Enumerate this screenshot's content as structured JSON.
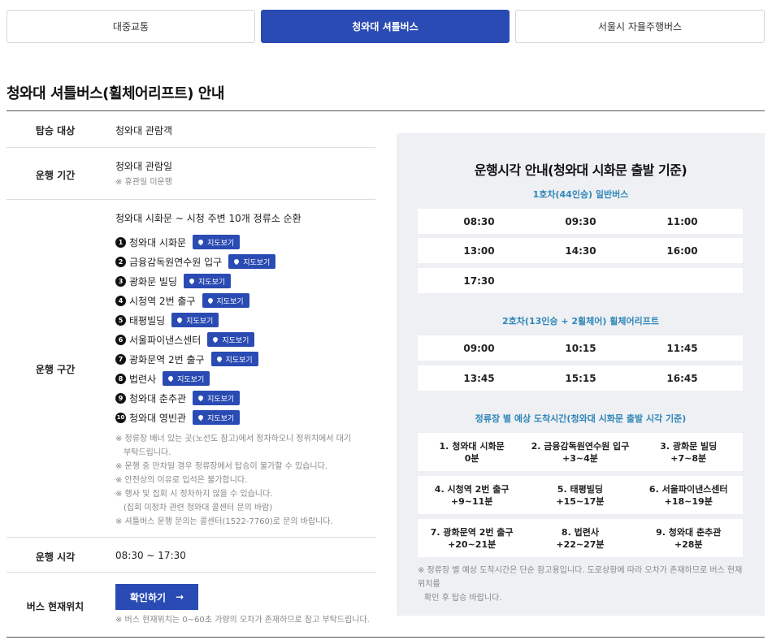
{
  "tabs": [
    {
      "label": "대중교통",
      "active": false
    },
    {
      "label": "청와대 셔틀버스",
      "active": true
    },
    {
      "label": "서울시 자율주행버스",
      "active": false
    }
  ],
  "title": "청와대 셔틀버스(휠체어리프트) 안내",
  "info": {
    "target": {
      "label": "탑승 대상",
      "value": "청와대 관람객"
    },
    "period": {
      "label": "운행 기간",
      "value": "청와대 관람일",
      "note": "※ 휴관일 미운행"
    },
    "route": {
      "label": "운행 구간",
      "summary": "청와대 시화문 ~ 시청 주변 10개 정류소 순환",
      "map_label": "지도보기",
      "stops": [
        {
          "num": "1",
          "name": "청와대 시화문"
        },
        {
          "num": "2",
          "name": "금융감독원연수원 입구"
        },
        {
          "num": "3",
          "name": "광화문 빌딩"
        },
        {
          "num": "4",
          "name": "시청역 2번 출구"
        },
        {
          "num": "5",
          "name": "태평빌딩"
        },
        {
          "num": "6",
          "name": "서울파이낸스센터"
        },
        {
          "num": "7",
          "name": "광화문역 2번 출구"
        },
        {
          "num": "8",
          "name": "법련사"
        },
        {
          "num": "9",
          "name": "청와대 춘추관"
        },
        {
          "num": "10",
          "name": "청와대 영빈관"
        }
      ],
      "notes": [
        "※ 정류장 배너 있는 곳(노선도 참고)에서 정차하오니 정위치에서 대기",
        "부탁드립니다.",
        "※ 운행 중 만차일 경우 정류장에서 탑승이 불가할 수 있습니다.",
        "※ 안전상의 이유로 입석은 불가합니다.",
        "※ 행사 및 집회 시 정차하지 않을 수 있습니다.",
        "(집회 미정차 관련 청와대 콜센터 문의 바람)",
        "※ 셔틀버스 운행 문의는 콜센터(1522-7760)로 문의 바랍니다."
      ]
    },
    "hours": {
      "label": "운행 시각",
      "value": "08:30 ~ 17:30"
    },
    "location": {
      "label": "버스 현재위치",
      "button": "확인하기",
      "arrow": "→",
      "note": "※ 버스 현재위치는 0~60초 가량의 오차가 존재하므로 참고 부탁드립니다."
    }
  },
  "schedule": {
    "title": "운행시각 안내(청와대 시화문 출발 기준)",
    "bus1": {
      "title": "1호차(44인승) 일반버스",
      "rows": [
        [
          "08:30",
          "09:30",
          "11:00"
        ],
        [
          "13:00",
          "14:30",
          "16:00"
        ],
        [
          "17:30",
          "",
          ""
        ]
      ]
    },
    "bus2": {
      "title": "2호차(13인승 + 2휠체어) 휠체어리프트",
      "rows": [
        [
          "09:00",
          "10:15",
          "11:45"
        ],
        [
          "13:45",
          "15:15",
          "16:45"
        ]
      ]
    },
    "arrival": {
      "title": "정류장 별 예상 도착시간(청와대 시화문 출발 시각 기준)",
      "rows": [
        [
          {
            "name": "1. 청와대 시화문",
            "time": "0분"
          },
          {
            "name": "2. 금융감독원연수원 입구",
            "time": "+3~4분"
          },
          {
            "name": "3. 광화문 빌딩",
            "time": "+7~8분"
          }
        ],
        [
          {
            "name": "4. 시청역 2번 출구",
            "time": "+9~11분"
          },
          {
            "name": "5. 태평빌딩",
            "time": "+15~17분"
          },
          {
            "name": "6. 서울파이낸스센터",
            "time": "+18~19분"
          }
        ],
        [
          {
            "name": "7. 광화문역 2번 출구",
            "time": "+20~21분"
          },
          {
            "name": "8. 법련사",
            "time": "+22~27분"
          },
          {
            "name": "9. 청와대 춘추관",
            "time": "+28분"
          }
        ]
      ]
    },
    "note1": "※ 정류장 별 예상 도착시간은 단순 참고용입니다. 도로상황에 따라 오차가 존재하므로 버스 현재 위치를",
    "note2": "확인 후 탑승 바랍니다."
  }
}
